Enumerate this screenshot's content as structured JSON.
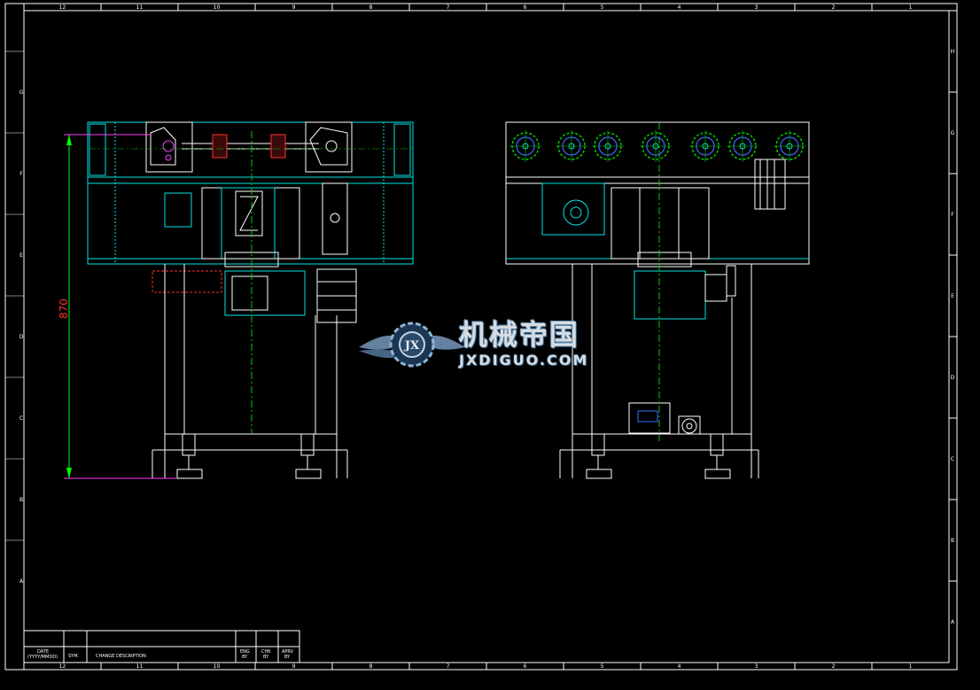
{
  "colors": {
    "frame": "#ffffff",
    "cyan": "#00e5e5",
    "green": "#00cc00",
    "blue": "#3a6bff",
    "red": "#ff3030",
    "magenta": "#ff40ff",
    "dim": "#ff3030",
    "dim_line": "#00ff00"
  },
  "frame": {
    "top_columns": [
      "12",
      "11",
      "10",
      "9",
      "8",
      "7",
      "6",
      "5",
      "4",
      "3",
      "2",
      "1"
    ],
    "bottom_columns": [
      "12",
      "11",
      "10",
      "9",
      "8",
      "7",
      "6",
      "5",
      "4",
      "3",
      "2",
      "1"
    ],
    "right_rows": [
      "H",
      "G",
      "F",
      "E",
      "D",
      "C",
      "B",
      "A"
    ],
    "left_rows": [
      "G",
      "F",
      "E",
      "D",
      "C",
      "B",
      "A"
    ]
  },
  "revision_block": {
    "date_label": "DATE",
    "date_format": "(YYYY/MMDD)",
    "sym_label": "SYM.",
    "change_label": "CHANGE DESCRIPTION",
    "eng_label": "ENG",
    "eng_by": "BY",
    "chk_label": "CHK",
    "chk_by": "BY",
    "apprv_label": "APRV",
    "apprv_by": "BY"
  },
  "dimension": {
    "height_value": "870"
  },
  "watermark": {
    "chinese": "机械帝国",
    "domain": "JXDIGUO.COM",
    "logo_letters": "JX"
  },
  "labels": {
    "nameplate": "░░░"
  }
}
